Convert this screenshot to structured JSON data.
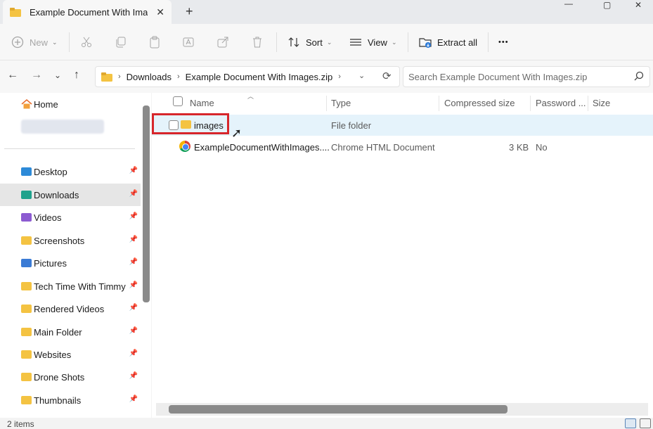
{
  "window": {
    "tab_title": "Example Document With Images.zip",
    "tab_title_visible": "Example Document With Imag",
    "new_tab": "+",
    "controls": [
      "—",
      "▢",
      "✕"
    ]
  },
  "toolbar": {
    "new_label": "New",
    "sort_label": "Sort",
    "view_label": "View",
    "extract_label": "Extract all",
    "more_label": "•••"
  },
  "address": {
    "crumbs": [
      "Downloads",
      "Example Document With Images.zip"
    ],
    "search_placeholder": "Search Example Document With Images.zip"
  },
  "sidebar": {
    "home": "Home",
    "items": [
      {
        "label": "Desktop",
        "color": "#2d8ad8"
      },
      {
        "label": "Downloads",
        "color": "#1fa28c"
      },
      {
        "label": "Videos",
        "color": "#8c5bd1"
      },
      {
        "label": "Screenshots",
        "color": "#f4c342"
      },
      {
        "label": "Pictures",
        "color": "#3a7bd5"
      },
      {
        "label": "Tech Time With Timmy",
        "color": "#f4c342"
      },
      {
        "label": "Rendered Videos",
        "color": "#f4c342"
      },
      {
        "label": "Main Folder",
        "color": "#f4c342"
      },
      {
        "label": "Websites",
        "color": "#f4c342"
      },
      {
        "label": "Drone Shots",
        "color": "#f4c342"
      },
      {
        "label": "Thumbnails",
        "color": "#f4c342"
      }
    ]
  },
  "columns": {
    "name": "Name",
    "type": "Type",
    "compressed": "Compressed size",
    "password": "Password ...",
    "size": "Size"
  },
  "files": [
    {
      "name": "images",
      "type": "File folder",
      "compressed": "",
      "password": ""
    },
    {
      "name": "ExampleDocumentWithImages....",
      "type": "Chrome HTML Document",
      "compressed": "3 KB",
      "password": "No"
    }
  ],
  "status": {
    "count": "2 items"
  }
}
